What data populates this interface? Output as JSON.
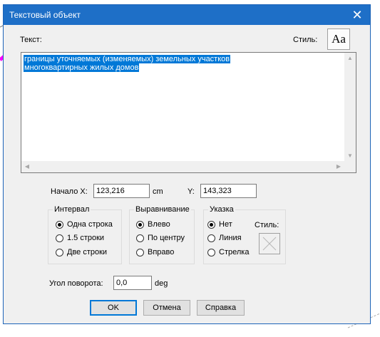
{
  "window": {
    "title": "Текстовый объект",
    "close_glyph": "✕"
  },
  "text_section": {
    "label": "Текст:",
    "style_label": "Стиль:",
    "font_button_label": "Aa",
    "lines": [
      "границы уточняемых (изменяемых) земельных участков",
      "многоквартирных жилых домов"
    ],
    "scroll_up_glyph": "▲",
    "scroll_down_glyph": "▼",
    "scroll_left_glyph": "◀",
    "scroll_right_glyph": "▶"
  },
  "position": {
    "x_label": "Начало X:",
    "x_value": "123,216",
    "x_unit": "cm",
    "y_label": "Y:",
    "y_value": "143,323"
  },
  "interval": {
    "title": "Интервал",
    "options": [
      {
        "label": "Одна строка",
        "selected": true
      },
      {
        "label": "1.5 строки",
        "selected": false
      },
      {
        "label": "Две строки",
        "selected": false
      }
    ]
  },
  "alignment": {
    "title": "Выравнивание",
    "options": [
      {
        "label": "Влево",
        "selected": true
      },
      {
        "label": "По центру",
        "selected": false
      },
      {
        "label": "Вправо",
        "selected": false
      }
    ]
  },
  "pointer": {
    "title": "Указка",
    "options": [
      {
        "label": "Нет",
        "selected": true
      },
      {
        "label": "Линия",
        "selected": false
      },
      {
        "label": "Стрелка",
        "selected": false
      }
    ],
    "style_label": "Стиль:"
  },
  "rotation": {
    "label": "Угол поворота:",
    "value": "0,0",
    "unit": "deg"
  },
  "buttons": {
    "ok": "OK",
    "cancel": "Отмена",
    "help": "Справка"
  },
  "colors": {
    "titlebar": "#1e6fc7",
    "selection": "#0078d7",
    "dialog_bg": "#f0f0f0",
    "magenta_line": "#ff00ff"
  }
}
